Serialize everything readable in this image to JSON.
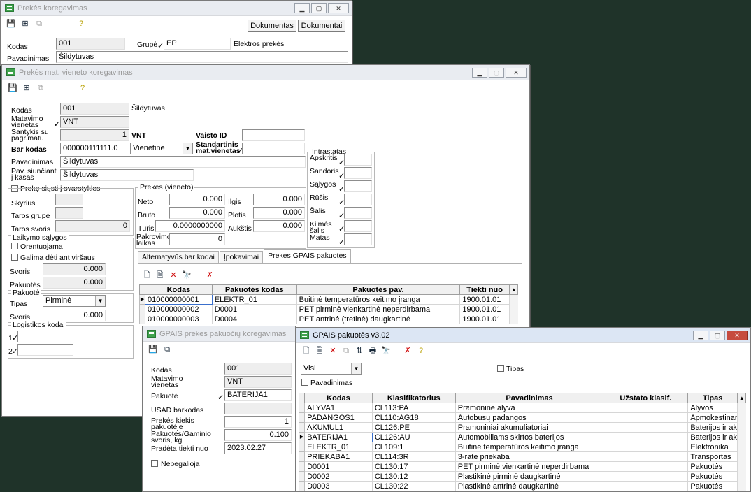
{
  "w1": {
    "title": "Prekės koregavimas",
    "btn_docs1": "Dokumentas",
    "btn_docs2": "Dokumentai",
    "kodas_label": "Kodas",
    "kodas": "001",
    "grupe_label": "Grupė",
    "grupe": "EP",
    "grupe_desc": "Elektros prekės",
    "pav_label": "Pavadinimas",
    "pav": "Šildytuvas"
  },
  "w2": {
    "title": "Prekės mat. vieneto koregavimas",
    "kodas_label": "Kodas",
    "kodas": "001",
    "kodas_desc": "Šildytuvas",
    "mat_label": "Matavimo vienetas",
    "mat": "VNT",
    "sant_label": "Santykis su pagr.matu",
    "sant": "1",
    "sant_unit": "VNT",
    "vaisto_label": "Vaisto ID",
    "bar_label": "Bar kodas",
    "bar": "000000111111.0",
    "bar_type": "Vienetinė",
    "std_label": "Standartinis mat.vienetas",
    "pav_label": "Pavadinimas",
    "pav": "Šildytuvas",
    "pav_kasas_label": "Pav. siunčiant į kasas",
    "pav_kasas": "Šildytuvas",
    "intrastat": {
      "title": "Intrastatas",
      "items": [
        "Apskritis",
        "Sandoris",
        "Sąlygos",
        "Rūšis",
        "Šalis",
        "Kilmės šalis",
        "Matas"
      ]
    },
    "svarstykles_label": "Prekę siųsti į svarstykles",
    "skyrius_label": "Skyrius",
    "taros_grupe_label": "Taros grupė",
    "taros_svoris_label": "Taros svoris",
    "taros_svoris": "0",
    "laikymo": {
      "title": "Laikymo sąlygos",
      "orient": "Orentuojama",
      "galima": "Galima dėti ant viršaus",
      "svoris_label": "Svoris",
      "svoris": "0.000",
      "pakuotes_label": "Pakuotės",
      "pakuotes": "0.000"
    },
    "pakuote": {
      "title": "Pakuotė",
      "tipas_label": "Tipas",
      "tipas": "Pirminė",
      "svoris_label": "Svoris",
      "svoris": "0.000"
    },
    "logist_label": "Logistikos kodai",
    "l1": "1",
    "l2": "2",
    "prekes": {
      "title": "Prekės (vieneto)",
      "neto_label": "Neto",
      "neto": "0.000",
      "bruto_label": "Bruto",
      "bruto": "0.000",
      "turis_label": "Tūris",
      "turis": "0.0000000000",
      "pakr_label": "Pakrovimo laikas",
      "pakr": "0",
      "ilgis_label": "Ilgis",
      "ilgis": "0.000",
      "plotis_label": "Plotis",
      "plotis": "0.000",
      "aukstis_label": "Aukštis",
      "aukstis": "0.000"
    },
    "tabs": [
      "Alternatyvūs bar kodai",
      "Įpokavimai",
      "Prekės GPAIS pakuotės"
    ],
    "grid": {
      "cols": [
        "Kodas",
        "Pakuotės kodas",
        "Pakuotės pav.",
        "Tiekti nuo"
      ],
      "rows": [
        [
          "010000000001",
          "ELEKTR_01",
          "Buitinė temperatūros keitimo įranga",
          "1900.01.01"
        ],
        [
          "010000000002",
          "D0001",
          "PET pirminė vienkartinė neperdirbama",
          "1900.01.01"
        ],
        [
          "010000000003",
          "D0004",
          "PET antrinė (tretinė) daugkartinė",
          "1900.01.01"
        ]
      ]
    }
  },
  "w3": {
    "title": "GPAIS prekes pakuočių koregavimas",
    "kodas_label": "Kodas",
    "kodas": "001",
    "mat_label": "Matavimo vienetas",
    "mat": "VNT",
    "pak_label": "Pakuotė",
    "pak": "BATERIJA1",
    "usad_label": "USAD barkodas",
    "kiekis_label": "Prekės kiekis pakuotėje",
    "kiekis": "1",
    "svoris_label": "Pakuotės/Gaminio svoris, kg",
    "svoris": "0.100",
    "pradeta_label": "Pradėta tiekti nuo",
    "pradeta": "2023.02.27",
    "neg_label": "Nebegalioja"
  },
  "w4": {
    "title": "GPAIS pakuotės v3.02",
    "filter": "Visi",
    "tipas_label": "Tipas",
    "pav_label": "Pavadinimas",
    "cols": [
      "Kodas",
      "Klasifikatorius",
      "Pavadinimas",
      "Užstato klasif.",
      "Tipas"
    ],
    "rows": [
      [
        "ALYVA1",
        "CL113:PA",
        "Pramoninė alyva",
        "",
        "Alyvos"
      ],
      [
        "PADANGOS1",
        "CL110:AG18",
        "Autobusų padangos",
        "",
        "Apmokestinam"
      ],
      [
        "AKUMUL1",
        "CL126:PE",
        "Pramoniniai akumuliatoriai",
        "",
        "Baterijos ir aku"
      ],
      [
        "BATERIJA1",
        "CL126:AU",
        "Automobiliams skirtos baterijos",
        "",
        "Baterijos ir aku"
      ],
      [
        "ELEKTR_01",
        "CL109:1",
        "Buitinė temperatūros keitimo įranga",
        "",
        "Elektronika"
      ],
      [
        "PRIEKABA1",
        "CL114:3R",
        "3-ratė priekaba",
        "",
        "Transportas"
      ],
      [
        "D0001",
        "CL130:17",
        "PET pirminė vienkartinė neperdirbama",
        "",
        "Pakuotės"
      ],
      [
        "D0002",
        "CL130:12",
        "Plastikinė pirminė daugkartinė",
        "",
        "Pakuotės"
      ],
      [
        "D0003",
        "CL130:22",
        "Plastikinė antrinė daugkartinė",
        "",
        "Pakuotės"
      ]
    ]
  }
}
